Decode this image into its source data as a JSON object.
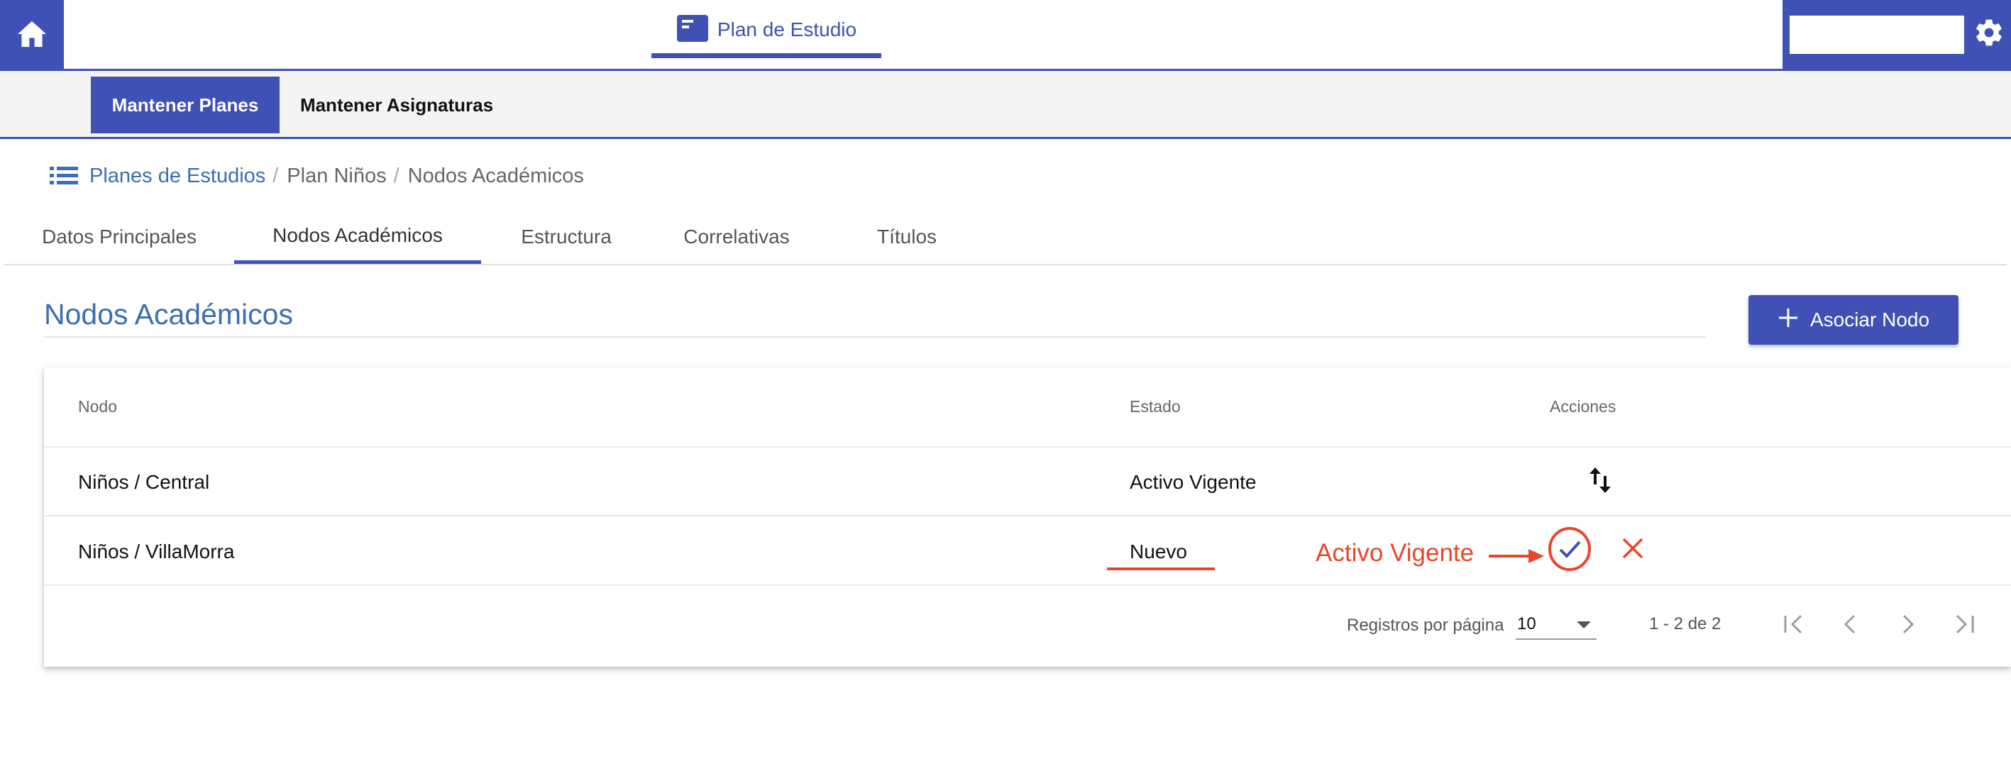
{
  "topbar": {
    "module_tab_label": "Plan de Estudio",
    "home_icon": "home-icon",
    "settings_icon": "gear-icon",
    "user_box_value": ""
  },
  "subnav": {
    "items": [
      {
        "label": "Mantener Planes",
        "active": true
      },
      {
        "label": "Mantener Asignaturas",
        "active": false
      }
    ]
  },
  "breadcrumb": {
    "items": [
      "Planes de Estudios",
      "Plan Niños",
      "Nodos Académicos"
    ],
    "separator": "/"
  },
  "tabs": [
    {
      "label": "Datos Principales"
    },
    {
      "label": "Nodos Académicos",
      "active": true
    },
    {
      "label": "Estructura"
    },
    {
      "label": "Correlativas"
    },
    {
      "label": "Títulos"
    }
  ],
  "section": {
    "title": "Nodos Académicos",
    "add_button_label": "Asociar Nodo"
  },
  "table": {
    "headers": [
      "Nodo",
      "Estado",
      "Acciones"
    ],
    "rows": [
      {
        "nodo": "Niños / Central",
        "estado": "Activo Vigente",
        "actions": [
          "swap-vertical-icon"
        ]
      },
      {
        "nodo": "Niños / VillaMorra",
        "estado": "Nuevo",
        "actions": [
          "check-icon",
          "close-icon"
        ]
      }
    ]
  },
  "annotation": {
    "text": "Activo Vigente"
  },
  "pagination": {
    "per_page_label": "Registros por página",
    "per_page_value": "10",
    "range_label": "1 - 2 de 2"
  },
  "colors": {
    "primary": "#3f51b5",
    "link": "#3a6fb0",
    "annotation": "#e8462a"
  }
}
